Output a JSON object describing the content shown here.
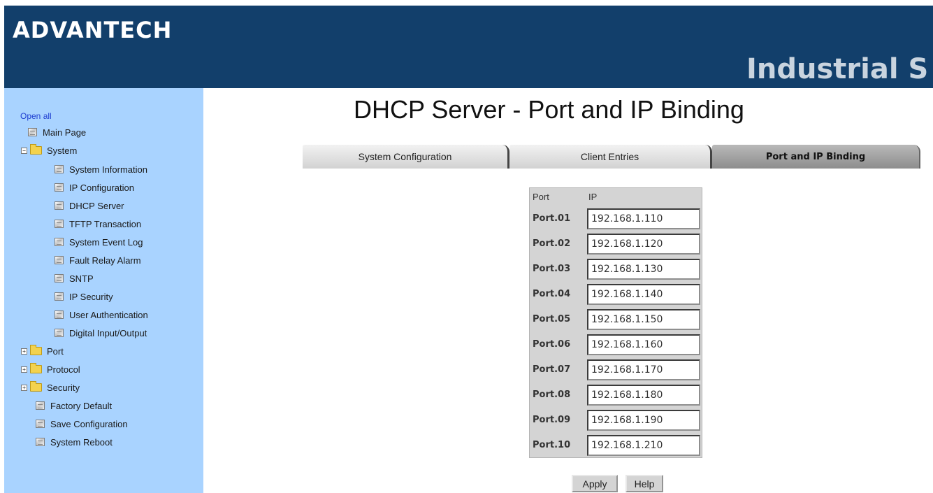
{
  "header": {
    "logo": "ADVANTECH",
    "product_title": "Industrial S"
  },
  "sidebar": {
    "open_all": "Open all",
    "items": [
      {
        "label": "Main Page",
        "icon": "page-icon"
      },
      {
        "label": "System",
        "icon": "folder-icon",
        "toggle": "−"
      },
      {
        "label": "System Information",
        "icon": "page-icon"
      },
      {
        "label": "IP Configuration",
        "icon": "page-icon"
      },
      {
        "label": "DHCP Server",
        "icon": "page-icon"
      },
      {
        "label": "TFTP Transaction",
        "icon": "page-icon"
      },
      {
        "label": "System Event Log",
        "icon": "page-icon"
      },
      {
        "label": "Fault Relay Alarm",
        "icon": "page-icon"
      },
      {
        "label": "SNTP",
        "icon": "page-icon"
      },
      {
        "label": "IP Security",
        "icon": "page-icon"
      },
      {
        "label": "User Authentication",
        "icon": "page-icon"
      },
      {
        "label": "Digital Input/Output",
        "icon": "page-icon"
      },
      {
        "label": "Port",
        "icon": "folder-icon",
        "toggle": "+"
      },
      {
        "label": "Protocol",
        "icon": "folder-icon",
        "toggle": "+"
      },
      {
        "label": "Security",
        "icon": "folder-icon",
        "toggle": "+"
      },
      {
        "label": "Factory Default",
        "icon": "page-icon"
      },
      {
        "label": "Save Configuration",
        "icon": "page-icon"
      },
      {
        "label": "System Reboot",
        "icon": "page-icon"
      }
    ]
  },
  "main": {
    "title": "DHCP Server - Port and IP Binding",
    "tabs": [
      {
        "label": "System Configuration",
        "active": false
      },
      {
        "label": "Client Entries",
        "active": false
      },
      {
        "label": "Port and IP Binding",
        "active": true
      }
    ],
    "table": {
      "headers": [
        "Port",
        "IP"
      ],
      "rows": [
        {
          "port": "Port.01",
          "ip": "192.168.1.110"
        },
        {
          "port": "Port.02",
          "ip": "192.168.1.120"
        },
        {
          "port": "Port.03",
          "ip": "192.168.1.130"
        },
        {
          "port": "Port.04",
          "ip": "192.168.1.140"
        },
        {
          "port": "Port.05",
          "ip": "192.168.1.150"
        },
        {
          "port": "Port.06",
          "ip": "192.168.1.160"
        },
        {
          "port": "Port.07",
          "ip": "192.168.1.170"
        },
        {
          "port": "Port.08",
          "ip": "192.168.1.180"
        },
        {
          "port": "Port.09",
          "ip": "192.168.1.190"
        },
        {
          "port": "Port.10",
          "ip": "192.168.1.210"
        }
      ]
    },
    "buttons": {
      "apply": "Apply",
      "help": "Help"
    }
  },
  "colors": {
    "header_bg": "#123f6b",
    "sidebar_bg": "#a9d3ff",
    "open_all_link": "#1f3fd1",
    "active_tab_bg": "#9a9a9a",
    "table_bg": "#d4d4d4"
  }
}
